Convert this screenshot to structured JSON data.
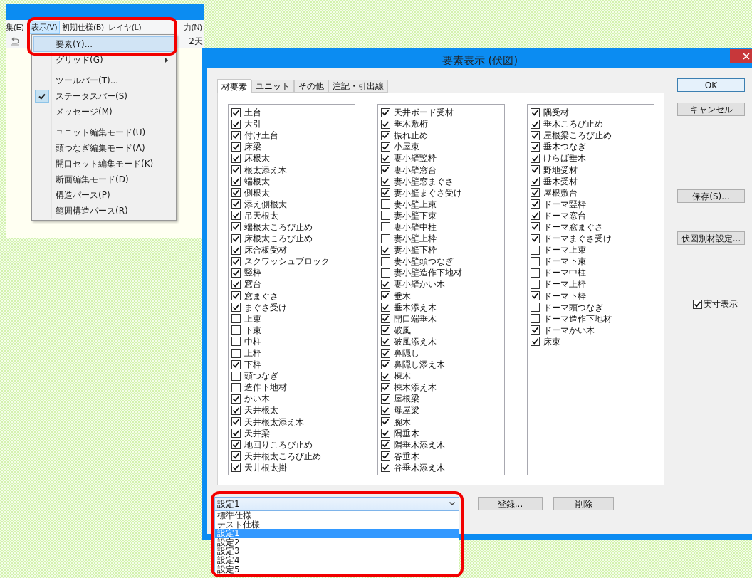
{
  "app_window": {
    "menubar": [
      {
        "label": "集(E)",
        "selected": false
      },
      {
        "label": "表示(V)",
        "selected": true
      },
      {
        "label": "初期仕様(B)",
        "selected": false
      },
      {
        "label": "レイヤ(L)",
        "selected": false
      },
      {
        "label": "力(N)",
        "selected": false
      }
    ],
    "toolbar_text": "2天",
    "menu": [
      {
        "kind": "item",
        "label": "要素(Y)...",
        "selected": true,
        "checked": false,
        "submenu": false
      },
      {
        "kind": "item",
        "label": "グリッド(G)",
        "selected": false,
        "checked": false,
        "submenu": true
      },
      {
        "kind": "separator"
      },
      {
        "kind": "item",
        "label": "ツールバー(T)...",
        "selected": false,
        "checked": false,
        "submenu": false
      },
      {
        "kind": "item",
        "label": "ステータスバー(S)",
        "selected": false,
        "checked": true,
        "submenu": false
      },
      {
        "kind": "item",
        "label": "メッセージ(M)",
        "selected": false,
        "checked": false,
        "submenu": false
      },
      {
        "kind": "separator"
      },
      {
        "kind": "item",
        "label": "ユニット編集モード(U)",
        "selected": false,
        "checked": false,
        "submenu": false
      },
      {
        "kind": "item",
        "label": "頭つなぎ編集モード(A)",
        "selected": false,
        "checked": false,
        "submenu": false
      },
      {
        "kind": "item",
        "label": "開口セット編集モード(K)",
        "selected": false,
        "checked": false,
        "submenu": false
      },
      {
        "kind": "item",
        "label": "断面編集モード(D)",
        "selected": false,
        "checked": false,
        "submenu": false
      },
      {
        "kind": "item",
        "label": "構造パース(P)",
        "selected": false,
        "checked": false,
        "submenu": false
      },
      {
        "kind": "item",
        "label": "範囲構造パース(R)",
        "selected": false,
        "checked": false,
        "submenu": false
      }
    ]
  },
  "dialog": {
    "title": "要素表示 (伏図)",
    "tabs": [
      {
        "label": "材要素",
        "selected": true
      },
      {
        "label": "ユニット",
        "selected": false
      },
      {
        "label": "その他",
        "selected": false
      },
      {
        "label": "注記・引出線",
        "selected": false
      }
    ],
    "columns": [
      [
        {
          "label": "土台",
          "checked": true
        },
        {
          "label": "大引",
          "checked": true
        },
        {
          "label": "付け土台",
          "checked": true
        },
        {
          "label": "床梁",
          "checked": true
        },
        {
          "label": "床根太",
          "checked": true
        },
        {
          "label": "根太添え木",
          "checked": true
        },
        {
          "label": "端根太",
          "checked": true
        },
        {
          "label": "側根太",
          "checked": true
        },
        {
          "label": "添え側根太",
          "checked": true
        },
        {
          "label": "吊天根太",
          "checked": true
        },
        {
          "label": "端根太ころび止め",
          "checked": true
        },
        {
          "label": "床根太ころび止め",
          "checked": true
        },
        {
          "label": "床合板受材",
          "checked": true
        },
        {
          "label": "スクワッシュブロック",
          "checked": true
        },
        {
          "label": "竪枠",
          "checked": true
        },
        {
          "label": "窓台",
          "checked": true
        },
        {
          "label": "窓まぐさ",
          "checked": true
        },
        {
          "label": "まぐさ受け",
          "checked": true
        },
        {
          "label": "上束",
          "checked": false
        },
        {
          "label": "下束",
          "checked": false
        },
        {
          "label": "中柱",
          "checked": false
        },
        {
          "label": "上枠",
          "checked": false
        },
        {
          "label": "下枠",
          "checked": true
        },
        {
          "label": "頭つなぎ",
          "checked": false
        },
        {
          "label": "造作下地材",
          "checked": false
        },
        {
          "label": "かい木",
          "checked": true
        },
        {
          "label": "天井根太",
          "checked": true
        },
        {
          "label": "天井根太添え木",
          "checked": true
        },
        {
          "label": "天井梁",
          "checked": true
        },
        {
          "label": "地回りころび止め",
          "checked": true
        },
        {
          "label": "天井根太ころび止め",
          "checked": true
        },
        {
          "label": "天井根太掛",
          "checked": true
        }
      ],
      [
        {
          "label": "天井ボード受材",
          "checked": true
        },
        {
          "label": "垂木敷桁",
          "checked": true
        },
        {
          "label": "振れ止め",
          "checked": true
        },
        {
          "label": "小屋束",
          "checked": true
        },
        {
          "label": "妻小壁竪枠",
          "checked": true
        },
        {
          "label": "妻小壁窓台",
          "checked": true
        },
        {
          "label": "妻小壁窓まぐさ",
          "checked": true
        },
        {
          "label": "妻小壁まぐさ受け",
          "checked": true
        },
        {
          "label": "妻小壁上束",
          "checked": false
        },
        {
          "label": "妻小壁下束",
          "checked": false
        },
        {
          "label": "妻小壁中柱",
          "checked": false
        },
        {
          "label": "妻小壁上枠",
          "checked": false
        },
        {
          "label": "妻小壁下枠",
          "checked": true
        },
        {
          "label": "妻小壁頭つなぎ",
          "checked": false
        },
        {
          "label": "妻小壁造作下地材",
          "checked": false
        },
        {
          "label": "妻小壁かい木",
          "checked": true
        },
        {
          "label": "垂木",
          "checked": true
        },
        {
          "label": "垂木添え木",
          "checked": true
        },
        {
          "label": "開口端垂木",
          "checked": true
        },
        {
          "label": "破風",
          "checked": true
        },
        {
          "label": "破風添え木",
          "checked": true
        },
        {
          "label": "鼻隠し",
          "checked": true
        },
        {
          "label": "鼻隠し添え木",
          "checked": true
        },
        {
          "label": "棟木",
          "checked": true
        },
        {
          "label": "棟木添え木",
          "checked": true
        },
        {
          "label": "屋根梁",
          "checked": true
        },
        {
          "label": "母屋梁",
          "checked": true
        },
        {
          "label": "腕木",
          "checked": true
        },
        {
          "label": "隅垂木",
          "checked": true
        },
        {
          "label": "隅垂木添え木",
          "checked": true
        },
        {
          "label": "谷垂木",
          "checked": true
        },
        {
          "label": "谷垂木添え木",
          "checked": true
        }
      ],
      [
        {
          "label": "隅受材",
          "checked": true
        },
        {
          "label": "垂木ころび止め",
          "checked": true
        },
        {
          "label": "屋根梁ころび止め",
          "checked": true
        },
        {
          "label": "垂木つなぎ",
          "checked": true
        },
        {
          "label": "けらば垂木",
          "checked": true
        },
        {
          "label": "野地受材",
          "checked": true
        },
        {
          "label": "垂木受材",
          "checked": true
        },
        {
          "label": "屋根敷台",
          "checked": true
        },
        {
          "label": "ドーマ竪枠",
          "checked": true
        },
        {
          "label": "ドーマ窓台",
          "checked": true
        },
        {
          "label": "ドーマ窓まぐさ",
          "checked": true
        },
        {
          "label": "ドーマまぐさ受け",
          "checked": true
        },
        {
          "label": "ドーマ上束",
          "checked": false
        },
        {
          "label": "ドーマ下束",
          "checked": false
        },
        {
          "label": "ドーマ中柱",
          "checked": false
        },
        {
          "label": "ドーマ上枠",
          "checked": false
        },
        {
          "label": "ドーマ下枠",
          "checked": true
        },
        {
          "label": "ドーマ頭つなぎ",
          "checked": false
        },
        {
          "label": "ドーマ造作下地材",
          "checked": false
        },
        {
          "label": "ドーマかい木",
          "checked": true
        },
        {
          "label": "床束",
          "checked": true
        }
      ]
    ],
    "buttons": [
      {
        "label": "OK",
        "default": true
      },
      {
        "label": "キャンセル",
        "default": false
      },
      {
        "label": "保存(S)...",
        "default": false
      },
      {
        "label": "伏図別材設定...",
        "default": false
      }
    ],
    "actual_size": {
      "label": "実寸表示",
      "checked": true
    },
    "preset": {
      "value": "設定1",
      "options": [
        {
          "label": "標準仕様",
          "selected": false
        },
        {
          "label": "テスト仕様",
          "selected": false
        },
        {
          "label": "設定1",
          "selected": true
        },
        {
          "label": "設定2",
          "selected": false
        },
        {
          "label": "設定3",
          "selected": false
        },
        {
          "label": "設定4",
          "selected": false
        },
        {
          "label": "設定5",
          "selected": false
        }
      ]
    },
    "register_button": "登録...",
    "delete_button": "削除"
  }
}
